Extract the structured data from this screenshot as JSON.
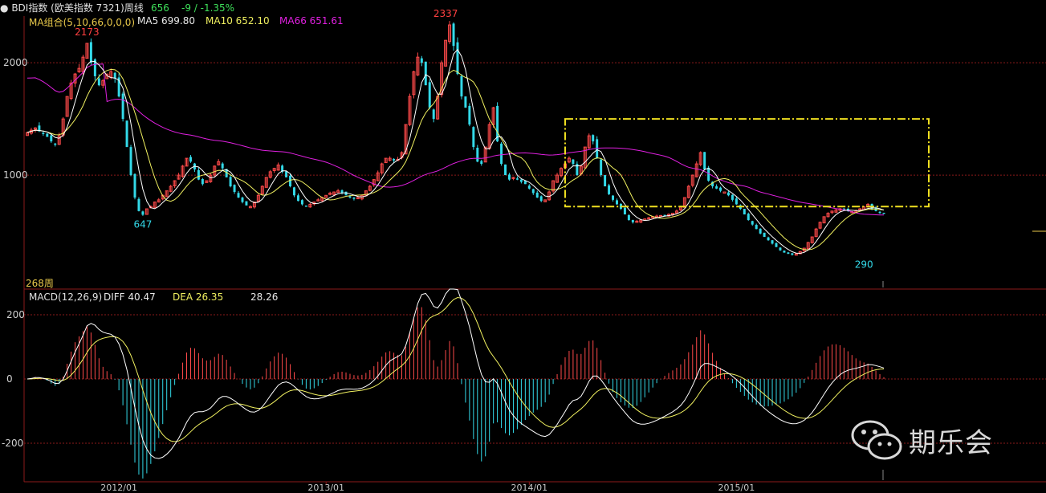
{
  "header": {
    "symbol_label": "BDI指数 (欧美指数 7321)周线",
    "last_value": "656",
    "change_text": "-9 / -1.35%"
  },
  "legend": {
    "ma_group": "MA组合(5,10,66,0,0,0)",
    "ma5": "MA5 699.80",
    "ma10": "MA10 652.10",
    "ma66": "MA66 651.61",
    "period_count": "268周"
  },
  "macd_legend": {
    "name": "MACD(12,26,9)",
    "diff": "DIFF  40.47",
    "dea": "DEA  26.35",
    "macd": "28.26"
  },
  "watermark": {
    "text": "期乐会"
  },
  "colors": {
    "background": "#000000",
    "up": "#ff4a4a",
    "down": "#33d9e8",
    "ma5": "#ffffff",
    "ma10": "#f0f060",
    "ma66": "#e020e0",
    "diff": "#ffffff",
    "dea": "#f0f060",
    "grid": "#8b1a1a",
    "box": "#f0e020",
    "label_high": "#ff4040",
    "label_low": "#33d9e8",
    "header_gold": "#e8c84a",
    "header_green": "#3ee05a"
  },
  "chart_data": [
    {
      "type": "candlestick",
      "title": "BDI指数 周线",
      "x_ticks": [
        "2012/01",
        "2013/01",
        "2014/01",
        "2015/01"
      ],
      "x_tick_weeks": [
        23,
        75,
        126,
        178
      ],
      "weeks": 268,
      "ylim": [
        0,
        2380
      ],
      "y_ticks": [
        1000,
        2000
      ],
      "grid": true,
      "close": [
        1380,
        1400,
        1420,
        1390,
        1370,
        1340,
        1300,
        1280,
        1350,
        1500,
        1700,
        1820,
        1900,
        1950,
        2050,
        2173,
        2000,
        1880,
        1800,
        1840,
        1900,
        1920,
        1860,
        1700,
        1500,
        1250,
        1000,
        800,
        680,
        647,
        700,
        720,
        760,
        780,
        820,
        860,
        900,
        950,
        1000,
        1080,
        1150,
        1120,
        1050,
        960,
        920,
        950,
        1000,
        1080,
        1120,
        1060,
        980,
        900,
        850,
        800,
        760,
        730,
        720,
        760,
        820,
        900,
        980,
        1030,
        1060,
        1090,
        1030,
        980,
        900,
        820,
        770,
        740,
        720,
        740,
        760,
        780,
        800,
        820,
        840,
        850,
        860,
        840,
        820,
        800,
        790,
        800,
        820,
        860,
        900,
        960,
        1020,
        1100,
        1150,
        1150,
        1130,
        1140,
        1200,
        1450,
        1700,
        1920,
        2050,
        2000,
        1800,
        1600,
        1500,
        1700,
        2000,
        2200,
        2337,
        2150,
        1900,
        1700,
        1600,
        1450,
        1250,
        1120,
        1100,
        1250,
        1450,
        1600,
        1300,
        1100,
        1000,
        960,
        980,
        960,
        940,
        920,
        880,
        840,
        800,
        770,
        780,
        850,
        950,
        1000,
        1060,
        1100,
        1150,
        1100,
        1000,
        1080,
        1250,
        1350,
        1300,
        1150,
        1000,
        900,
        830,
        780,
        740,
        700,
        650,
        600,
        580,
        590,
        600,
        610,
        620,
        630,
        635,
        640,
        645,
        650,
        660,
        680,
        720,
        800,
        900,
        1000,
        1100,
        1200,
        1050,
        950,
        900,
        880,
        860,
        850,
        820,
        780,
        740,
        700,
        650,
        600,
        560,
        520,
        480,
        450,
        420,
        390,
        360,
        330,
        310,
        300,
        290,
        300,
        320,
        350,
        400,
        450,
        520,
        580,
        630,
        660,
        680,
        690,
        700,
        690,
        680,
        675,
        680,
        700,
        720,
        740,
        700,
        680,
        665,
        656
      ],
      "labels": [
        {
          "text": "2173",
          "kind": "high",
          "week": 15,
          "value": 2173
        },
        {
          "text": "647",
          "kind": "low",
          "week": 29,
          "value": 647
        },
        {
          "text": "2337",
          "kind": "high",
          "week": 105,
          "value": 2337
        },
        {
          "text": "290",
          "kind": "low",
          "week": 210,
          "value": 290
        }
      ],
      "series": [
        {
          "name": "MA5",
          "value": 699.8
        },
        {
          "name": "MA10",
          "value": 652.1
        },
        {
          "name": "MA66",
          "value": 651.61
        }
      ],
      "annotation_box": {
        "x_weeks": [
          135,
          279
        ],
        "y_values": [
          720,
          1500
        ]
      }
    },
    {
      "type": "macd",
      "title": "MACD(12,26,9)",
      "y_ticks": [
        200,
        0,
        -200
      ],
      "ylim": [
        -320,
        280
      ],
      "series": [
        {
          "name": "DIFF",
          "value": 40.47
        },
        {
          "name": "DEA",
          "value": 26.35
        },
        {
          "name": "MACD",
          "value": 28.26
        }
      ]
    }
  ]
}
